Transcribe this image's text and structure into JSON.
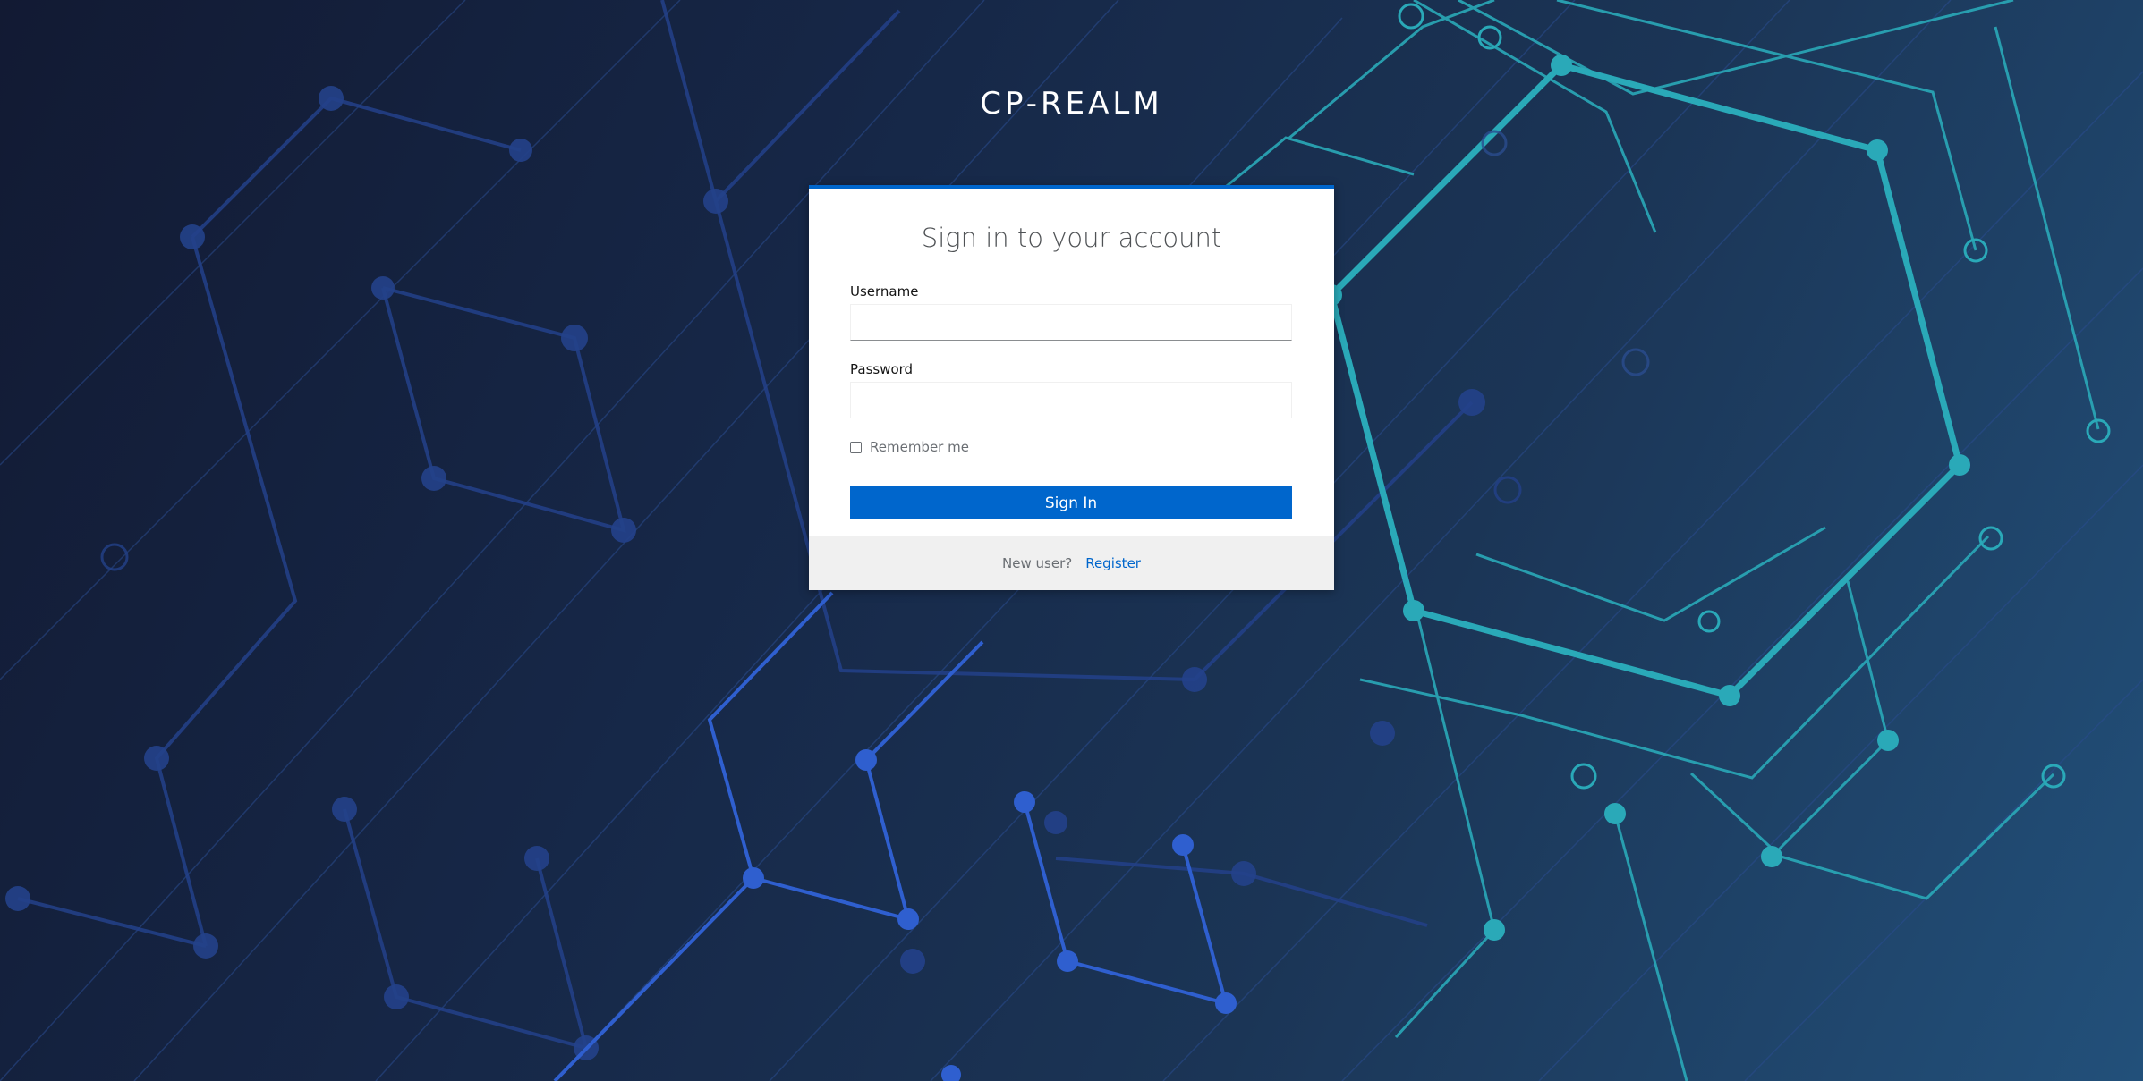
{
  "realm": {
    "title": "CP-REALM"
  },
  "login": {
    "heading": "Sign in to your account",
    "username_label": "Username",
    "username_value": "",
    "password_label": "Password",
    "password_value": "",
    "remember_label": "Remember me",
    "remember_checked": false,
    "submit_label": "Sign In"
  },
  "footer": {
    "new_user_text": "New user?",
    "register_link": "Register"
  },
  "colors": {
    "accent": "#0066cc",
    "background_dark": "#121a33",
    "background_light": "#22507a",
    "circuit_teal": "#2aa9b8",
    "circuit_blue": "#2f5fcf"
  }
}
